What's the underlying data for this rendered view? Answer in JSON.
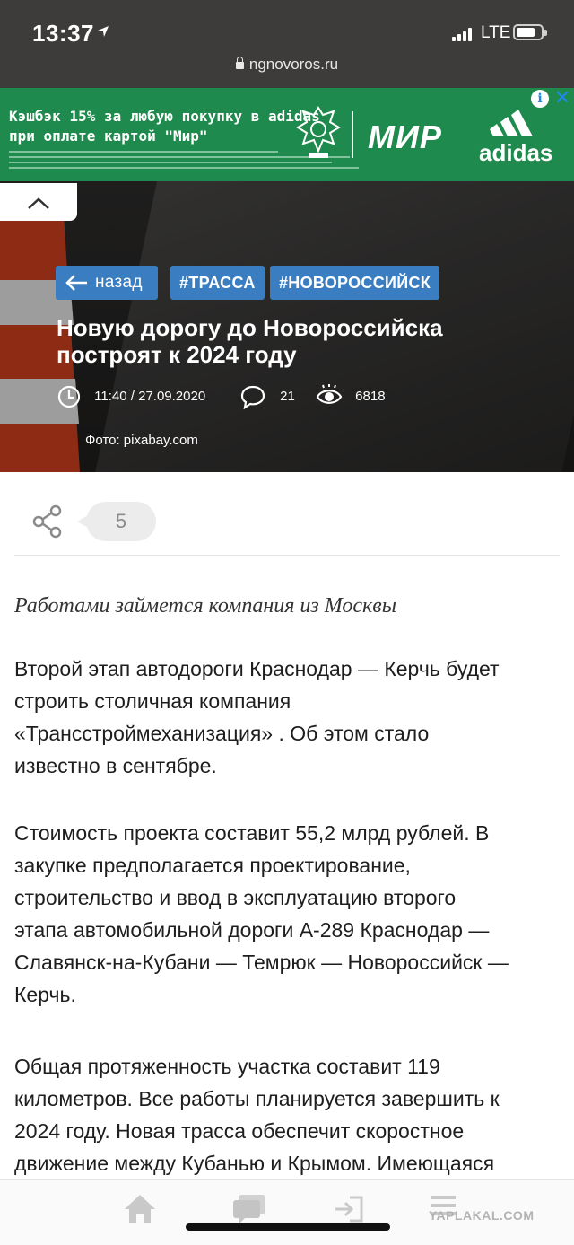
{
  "status_bar": {
    "time": "13:37",
    "network": "LTE"
  },
  "browser": {
    "url": "ngnovoros.ru"
  },
  "ad": {
    "line1": "Кэшбэк 15% за любую покупку в adidas",
    "line2": "при оплате картой \"Мир\"",
    "brand_mir": "МИР",
    "brand_adidas": "adidas",
    "info_label": "i",
    "close_label": "✕"
  },
  "article": {
    "back_label": "назад",
    "tags": [
      "#ТРАССА",
      "#НОВОРОССИЙСК"
    ],
    "title_line1": "Новую дорогу до Новороссийска",
    "title_line2": "построят к 2024 году",
    "datetime": "11:40 / 27.09.2020",
    "comments": "21",
    "views": "6818",
    "photo_credit": "Фото:  pixabay.com",
    "share_count": "5",
    "lead": "Работами займется компания из Москвы",
    "paragraphs": [
      [
        "Второй этап автодороги Краснодар — Керчь будет",
        "строить столичная компания",
        "«Трансстроймеханизация» . Об этом стало",
        "известно в сентябре."
      ],
      [
        "Стоимость проекта составит 55,2 млрд рублей. В",
        "закупке предполагается проектирование,",
        "строительство и ввод в эксплуатацию второго",
        "этапа автомобильной дороги А-289 Краснодар —",
        "Славянск-на-Кубани — Темрюк — Новороссийск —",
        "Керчь."
      ],
      [
        "Общая протяженность участка составит 119",
        "километров. Все работы планируется завершить к",
        "2024 году. Новая трасса обеспечит скоростное",
        "движение между Кубанью и Крымом. Имеющаяся"
      ]
    ]
  },
  "watermark": "YAPLAKAL.COM",
  "colors": {
    "tag_blue": "#3a7dc0",
    "ad_green": "#1f8a4d"
  },
  "icons": [
    "location-arrow-icon",
    "signal-icon",
    "battery-icon",
    "lock-icon",
    "chevron-up-icon",
    "arrow-left-icon",
    "clock-icon",
    "comment-icon",
    "eye-icon",
    "share-icon",
    "home-icon",
    "chat-icon",
    "login-icon",
    "menu-icon"
  ]
}
